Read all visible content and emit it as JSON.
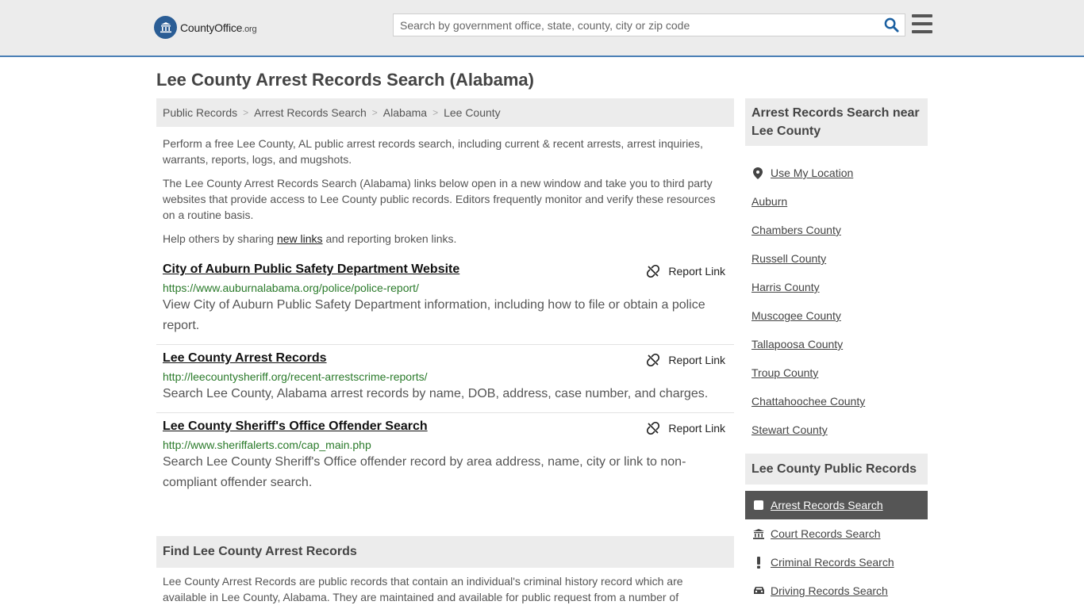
{
  "site": {
    "logo_main": "CountyOffice",
    "logo_suffix": ".org"
  },
  "search": {
    "placeholder": "Search by government office, state, county, city or zip code"
  },
  "page": {
    "title": "Lee County Arrest Records Search (Alabama)"
  },
  "breadcrumb": [
    "Public Records",
    "Arrest Records Search",
    "Alabama",
    "Lee County"
  ],
  "intro": {
    "p1": "Perform a free Lee County, AL public arrest records search, including current & recent arrests, arrest inquiries, warrants, reports, logs, and mugshots.",
    "p2": "The Lee County Arrest Records Search (Alabama) links below open in a new window and take you to third party websites that provide access to Lee County public records. Editors frequently monitor and verify these resources on a routine basis.",
    "p3_before": "Help others by sharing ",
    "p3_link": "new links",
    "p3_after": " and reporting broken links."
  },
  "results": [
    {
      "title": "City of Auburn Public Safety Department Website",
      "url": "https://www.auburnalabama.org/police/police-report/",
      "description": "View City of Auburn Public Safety Department information, including how to file or obtain a police report.",
      "report_label": "Report Link"
    },
    {
      "title": "Lee County Arrest Records",
      "url": "http://leecountysheriff.org/recent-arrestscrime-reports/",
      "description": "Search Lee County, Alabama arrest records by name, DOB, address, case number, and charges.",
      "report_label": "Report Link"
    },
    {
      "title": "Lee County Sheriff's Office Offender Search",
      "url": "http://www.sheriffalerts.com/cap_main.php",
      "description": "Search Lee County Sheriff's Office offender record by area address, name, city or link to non-compliant offender search.",
      "report_label": "Report Link"
    }
  ],
  "find_section": {
    "title": "Find Lee County Arrest Records",
    "text": "Lee County Arrest Records are public records that contain an individual's criminal history record which are available in Lee County, Alabama. They are maintained and available for public request from a number of"
  },
  "sidebar": {
    "near_title": "Arrest Records Search near Lee County",
    "use_location": "Use My Location",
    "near_items": [
      "Auburn",
      "Chambers County",
      "Russell County",
      "Harris County",
      "Muscogee County",
      "Tallapoosa County",
      "Troup County",
      "Chattahoochee County",
      "Stewart County"
    ],
    "records_title": "Lee County Public Records",
    "records_items": [
      {
        "label": "Arrest Records Search",
        "icon": "square-icon",
        "active": true
      },
      {
        "label": "Court Records Search",
        "icon": "courthouse-icon",
        "active": false
      },
      {
        "label": "Criminal Records Search",
        "icon": "exclamation-icon",
        "active": false
      },
      {
        "label": "Driving Records Search",
        "icon": "car-icon",
        "active": false
      }
    ]
  },
  "colors": {
    "header_bg": "#ececec",
    "header_border": "#4a7fb5",
    "url_green": "#2a7a2a",
    "logo_blue": "#2a5d95",
    "search_icon": "#1a5fa0",
    "active_item": "#555555"
  }
}
